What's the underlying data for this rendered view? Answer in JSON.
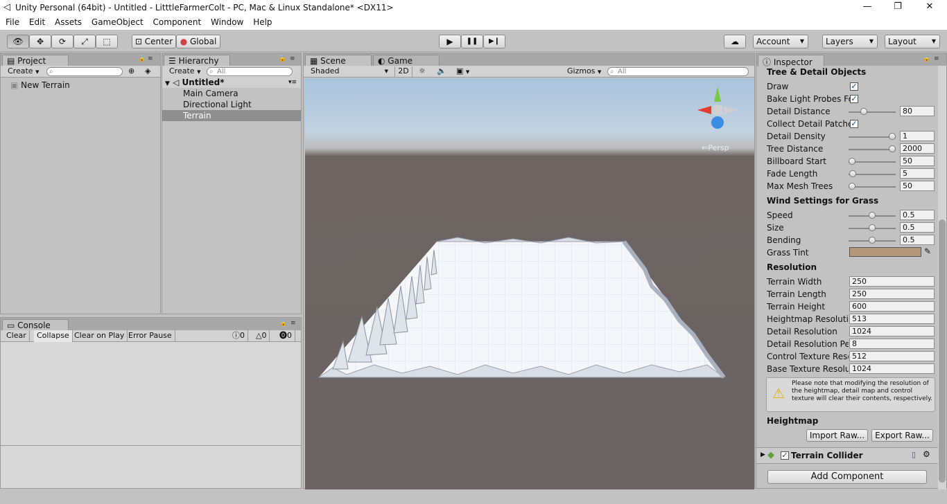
{
  "window": {
    "title": "Unity Personal (64bit) - Untitled - LitttleFarmerColt - PC, Mac & Linux Standalone* <DX11>",
    "icon": "unity-logo-icon",
    "minimize": "—",
    "restore": "❐",
    "close": "✕"
  },
  "menu": [
    "File",
    "Edit",
    "Assets",
    "GameObject",
    "Component",
    "Window",
    "Help"
  ],
  "toolbar": {
    "tools": [
      "view-hand-icon",
      "move-icon",
      "rotate-icon",
      "scale-icon",
      "rect-icon"
    ],
    "tool_glyphs": [
      "👁",
      "✥",
      "⟳",
      "⤢",
      "⬚"
    ],
    "pivot": "Center",
    "space": "Global",
    "play": "▶",
    "pause": "❚❚",
    "step": "▶❙",
    "cloud": "☁",
    "account": "Account",
    "layers": "Layers",
    "layout": "Layout"
  },
  "project": {
    "tab": "Project",
    "create": "Create",
    "items": [
      "New Terrain"
    ]
  },
  "hierarchy": {
    "tab": "Hierarchy",
    "create": "Create",
    "search_placeholder": "All",
    "scene": "Untitled*",
    "items": [
      "Main Camera",
      "Directional Light",
      "Terrain"
    ],
    "selected": "Terrain"
  },
  "scene": {
    "tab_scene": "Scene",
    "tab_game": "Game",
    "shading": "Shaded",
    "mode2d": "2D",
    "gizmos": "Gizmos",
    "search_placeholder": "All",
    "persp": "Persp"
  },
  "console": {
    "tab": "Console",
    "buttons": [
      "Clear",
      "Collapse",
      "Clear on Play",
      "Error Pause"
    ],
    "counts": [
      "0",
      "0",
      "0"
    ]
  },
  "inspector": {
    "tab": "Inspector",
    "section_tree": "Tree & Detail Objects",
    "draw_label": "Draw",
    "bake_label": "Bake Light Probes Fo",
    "detail_distance_label": "Detail Distance",
    "detail_distance": "80",
    "collect_label": "Collect Detail Patche",
    "detail_density_label": "Detail Density",
    "detail_density": "1",
    "tree_distance_label": "Tree Distance",
    "tree_distance": "2000",
    "billboard_label": "Billboard Start",
    "billboard": "50",
    "fade_label": "Fade Length",
    "fade": "5",
    "maxmesh_label": "Max Mesh Trees",
    "maxmesh": "50",
    "section_wind": "Wind Settings for Grass",
    "speed_label": "Speed",
    "speed": "0.5",
    "size_label": "Size",
    "size": "0.5",
    "bending_label": "Bending",
    "bending": "0.5",
    "tint_label": "Grass Tint",
    "tint_color": "#b5977c",
    "section_res": "Resolution",
    "terrain_width_label": "Terrain Width",
    "terrain_width": "250",
    "terrain_length_label": "Terrain Length",
    "terrain_length": "250",
    "terrain_height_label": "Terrain Height",
    "terrain_height": "600",
    "heightmap_res_label": "Heightmap Resolutio",
    "heightmap_res": "513",
    "detail_res_label": "Detail Resolution",
    "detail_res": "1024",
    "detail_res_per_label": "Detail Resolution Per",
    "detail_res_per": "8",
    "control_tex_label": "Control Texture Reso",
    "control_tex": "512",
    "base_tex_label": "Base Texture Resolu",
    "base_tex": "1024",
    "note": "Please note that modifying the resolution of the heightmap, detail map and control texture will clear their contents, respectively.",
    "section_heightmap": "Heightmap",
    "import_raw": "Import Raw...",
    "export_raw": "Export Raw...",
    "collider": "Terrain Collider",
    "add_component": "Add Component"
  },
  "colors": {
    "accent_gizmo_y": "#7ac943",
    "accent_gizmo_x": "#e33b2e",
    "accent_gizmo_z": "#3b8ee3"
  }
}
